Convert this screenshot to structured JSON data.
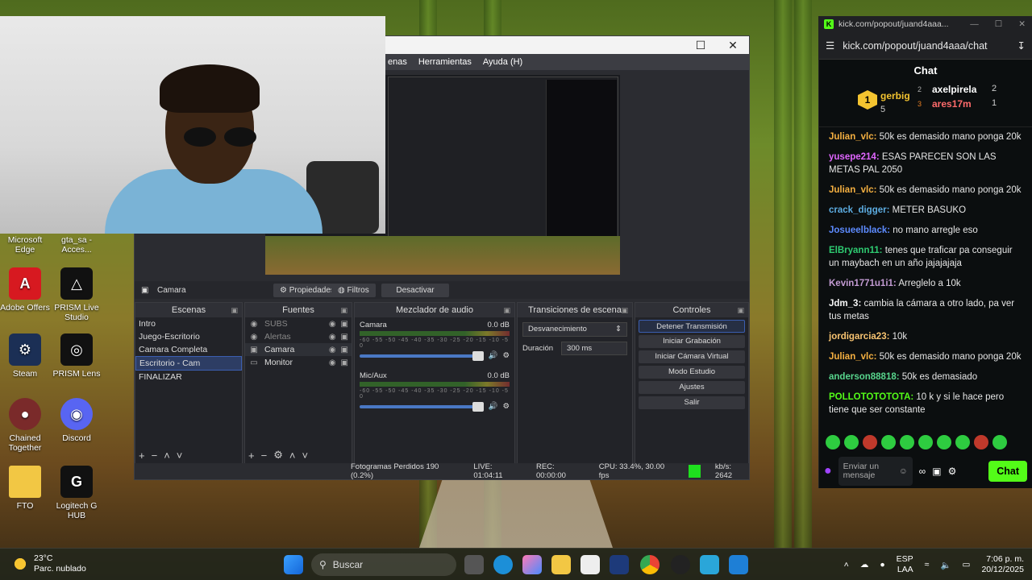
{
  "desktop_icons": [
    {
      "label": "Microsoft Edge"
    },
    {
      "label": "gta_sa - Acces..."
    },
    {
      "label": "Adobe Offers"
    },
    {
      "label": "PRISM Live Studio"
    },
    {
      "label": "Steam"
    },
    {
      "label": "PRISM Lens"
    },
    {
      "label": "Chained Together"
    },
    {
      "label": "Discord"
    },
    {
      "label": "FTO"
    },
    {
      "label": "Logitech G HUB"
    }
  ],
  "obs": {
    "menu": [
      "enas",
      "Herramientas",
      "Ayuda (H)"
    ],
    "source_bar": {
      "source_name": "Camara",
      "properties": "Propiedades",
      "filters": "Filtros",
      "deactivate": "Desactivar"
    },
    "scenes": {
      "title": "Escenas",
      "items": [
        "Intro",
        "Juego-Escritorio",
        "Camara Completa",
        "Escritorio - Cam",
        "FINALIZAR"
      ]
    },
    "sources": {
      "title": "Fuentes",
      "items": [
        "SUBS",
        "Alertas",
        "Camara",
        "Monitor"
      ]
    },
    "mixer": {
      "title": "Mezclador de audio",
      "channels": [
        {
          "name": "Camara",
          "db": "0.0 dB"
        },
        {
          "name": "Mic/Aux",
          "db": "0.0 dB"
        }
      ],
      "scale": "-60 -55 -50 -45 -40 -35 -30 -25 -20 -15 -10 -5 0"
    },
    "transitions": {
      "title": "Transiciones de escena",
      "selected": "Desvanecimiento",
      "duration_label": "Duración",
      "duration_value": "300 ms"
    },
    "controls": {
      "title": "Controles",
      "buttons": [
        "Detener Transmisión",
        "Iniciar Grabación",
        "Iniciar Cámara Virtual",
        "Modo Estudio",
        "Ajustes",
        "Salir"
      ]
    },
    "status": {
      "dropped": "Fotogramas Perdidos 190 (0.2%)",
      "live": "LIVE: 01:04:11",
      "rec": "REC: 00:00:00",
      "cpu": "CPU: 33.4%, 30.00 fps",
      "kbs": "kb/s: 2642"
    }
  },
  "kick": {
    "window_title": "kick.com/popout/juand4aaa...",
    "url": "kick.com/popout/juand4aaa/chat",
    "chat_title": "Chat",
    "leaderboard": [
      {
        "rank": "1",
        "user": "gerbig",
        "count": "5"
      },
      {
        "rank": "2",
        "user": "axelpirela",
        "count": "2"
      },
      {
        "rank": "3",
        "user": "ares17m",
        "count": "1"
      }
    ],
    "messages": [
      {
        "user": "Julian_vlc",
        "color": "#f5b041",
        "text": " 50k es demasido mano ponga 20k"
      },
      {
        "user": "yusepe214",
        "color": "#e066ff",
        "text": " ESAS PARECEN SON LAS METAS PAL 2050"
      },
      {
        "user": "Julian_vlc",
        "color": "#f5b041",
        "text": " 50k es demasido mano ponga 20k"
      },
      {
        "user": "crack_digger",
        "color": "#5dade2",
        "text": " METER BASUKO"
      },
      {
        "user": "Josueelblack",
        "color": "#5d8bff",
        "text": " no mano arregle eso"
      },
      {
        "user": "ElBryann11",
        "color": "#2ecc71",
        "text": " tenes que traficar pa conseguir un maybach en un año jajajajaja"
      },
      {
        "user": "Kevin1771u1i1",
        "color": "#c39bd3",
        "text": " Arreglelo a 10k"
      },
      {
        "user": "Jdm_3",
        "color": "#f8f8f8",
        "text": " cambia la cámara a otro lado, pa ver tus metas"
      },
      {
        "user": "jordigarcia23",
        "color": "#f8c471",
        "text": " 10k"
      },
      {
        "user": "Julian_vlc",
        "color": "#f5b041",
        "text": " 50k es demasido mano ponga 20k"
      },
      {
        "user": "anderson88818",
        "color": "#58d68d",
        "text": " 50k es demasiado"
      },
      {
        "user": "POLLOTOTOTOTA",
        "color": "#53fc18",
        "text": " 10 k y si le hace pero tiene que ser constante"
      }
    ],
    "input_placeholder": "Enviar un mensaje",
    "send_label": "Chat"
  },
  "taskbar": {
    "temperature": "23°C",
    "weather": "Parc. nublado",
    "search_placeholder": "Buscar",
    "lang_top": "ESP",
    "lang_bottom": "LAA",
    "time": "7:06 p. m.",
    "date": "20/12/2025"
  },
  "colors": {
    "kick_green": "#53fc18",
    "obs_bg": "#2b2c31",
    "selection_blue": "#3b5eb0"
  }
}
